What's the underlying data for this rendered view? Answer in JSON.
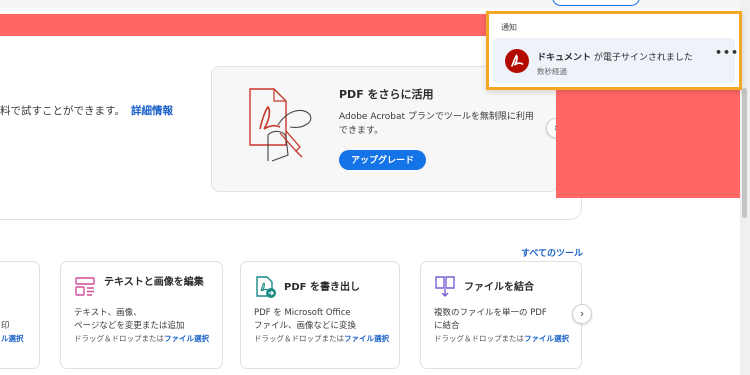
{
  "hero": {
    "text": "料で試すことができます。",
    "link": "詳細情報"
  },
  "promo": {
    "title": "PDF をさらに活用",
    "desc": "Adobe Acrobat プランでツールを無制限に利用できます。",
    "button": "アップグレード",
    "next_icon": "›"
  },
  "tools": {
    "all_link": "すべてのツール",
    "cards": [
      {
        "title": "",
        "desc": [
          "",
          "印"
        ],
        "drag_prefix": "",
        "drag_link": "ル選択"
      },
      {
        "title": "テキストと画像を編集",
        "desc": [
          "テキスト、画像、",
          "ページなどを変更または追加"
        ],
        "drag_prefix": "ドラッグ＆ドロップまたは",
        "drag_link": "ファイル選択"
      },
      {
        "title": "PDF を書き出し",
        "desc": [
          "PDF を Microsoft Office",
          "ファイル、画像などに変換"
        ],
        "drag_prefix": "ドラッグ＆ドロップまたは",
        "drag_link": "ファイル選択"
      },
      {
        "title": "ファイルを結合",
        "desc": [
          "複数のファイルを単一の PDF",
          "に結合"
        ],
        "drag_prefix": "ドラッグ＆ドロップまたは",
        "drag_link": "ファイル選択"
      }
    ],
    "next_icon": "›"
  },
  "notification": {
    "header": "通知",
    "title_bold": "ドキュメント",
    "title_rest": " が電子サインされました",
    "time": "数秒経過",
    "more_icon": "•••"
  },
  "colors": {
    "accent": "#1473e6",
    "link": "#1b61c9",
    "red": "#ff6666",
    "highlight": "#f5a623",
    "acrobat": "#b30b00"
  }
}
